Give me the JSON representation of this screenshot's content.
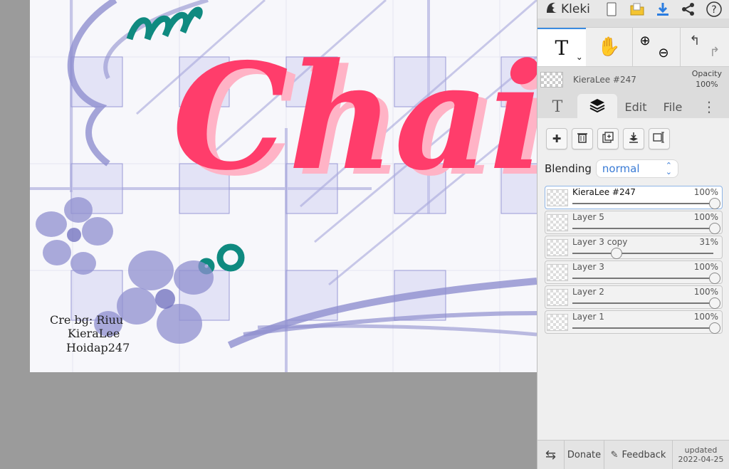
{
  "app": {
    "logo_text": "Kleki",
    "top_icons": [
      "new-file-icon",
      "folder-icon",
      "download-icon",
      "share-icon",
      "help-icon"
    ]
  },
  "canvas": {
    "title_text": "Chain",
    "credits": [
      "Cre bg: Riuu",
      "KieraLee",
      "Hoidap247"
    ],
    "colors": {
      "pink": "#ff3d6b",
      "lavender": "#8f8fcf",
      "teal": "#0f8a80"
    }
  },
  "toolbar": {
    "text_tool": "T",
    "zoom_in": "⊕",
    "zoom_out": "⊖",
    "undo": "↰",
    "redo": "↱"
  },
  "current_layer": {
    "name": "KieraLee #247",
    "opacity_label": "Opacity",
    "opacity_value": "100%"
  },
  "tabs": {
    "text": "T",
    "edit": "Edit",
    "file": "File",
    "more": "⋮"
  },
  "blending": {
    "label": "Blending",
    "value": "normal"
  },
  "layers": [
    {
      "name": "KieraLee #247",
      "opacity": "100%",
      "level": 1.0,
      "selected": true
    },
    {
      "name": "Layer 5",
      "opacity": "100%",
      "level": 1.0,
      "selected": false
    },
    {
      "name": "Layer 3 copy",
      "opacity": "31%",
      "level": 0.31,
      "selected": false
    },
    {
      "name": "Layer 3",
      "opacity": "100%",
      "level": 1.0,
      "selected": false
    },
    {
      "name": "Layer 2",
      "opacity": "100%",
      "level": 1.0,
      "selected": false
    },
    {
      "name": "Layer 1",
      "opacity": "100%",
      "level": 1.0,
      "selected": false
    }
  ],
  "footer": {
    "donate": "Donate",
    "feedback": "Feedback",
    "updated_label": "updated",
    "updated_date": "2022-04-25"
  }
}
